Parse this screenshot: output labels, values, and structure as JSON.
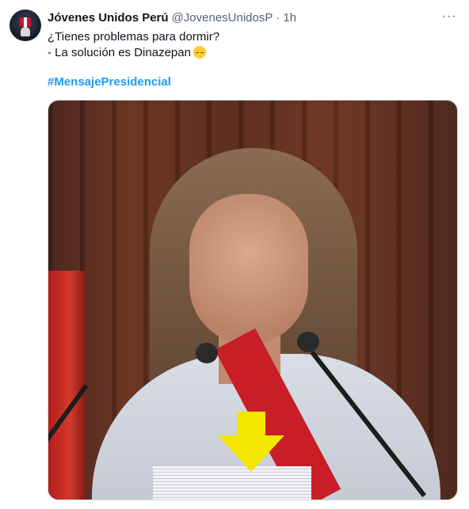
{
  "tweet": {
    "author_name": "Jóvenes Unidos Perú",
    "handle": "@JovenesUnidosP",
    "separator": "·",
    "time": "1h",
    "more_label": "···",
    "text_lines": [
      "¿Tienes problemas para dormir?",
      "- La solución es Dinazepan"
    ],
    "hashtag": "#MensajePresidencial",
    "emoji": "sleeping-face-emoji"
  },
  "colors": {
    "link": "#1d9bf0",
    "secondary_text": "#536471",
    "arrow": "#f5e600"
  }
}
